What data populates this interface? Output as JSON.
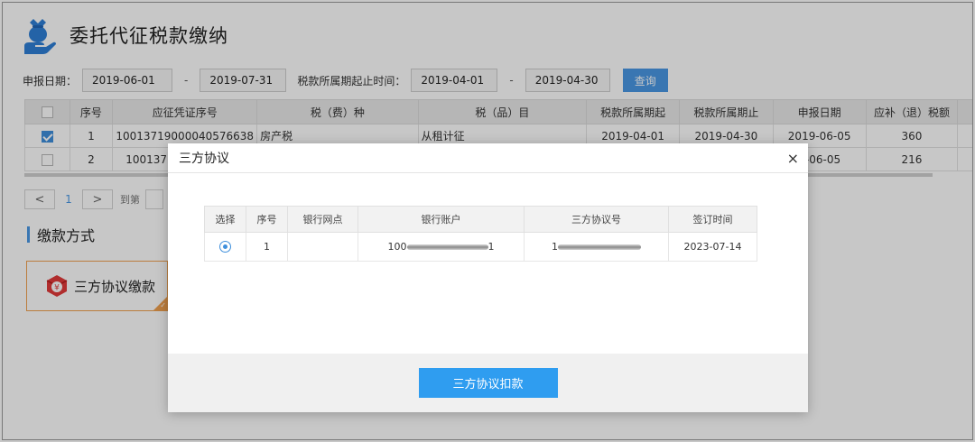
{
  "page": {
    "title": "委托代征税款缴纳"
  },
  "filters": {
    "report_date_label": "申报日期：",
    "report_date_from": "2019-06-01",
    "report_date_to": "2019-07-31",
    "range_separator": "-",
    "tax_period_label": "税款所属期起止时间：",
    "tax_period_from": "2019-04-01",
    "tax_period_to": "2019-04-30",
    "query_button": "查询"
  },
  "table": {
    "columns": [
      "",
      "序号",
      "应征凭证序号",
      "税（费）种",
      "税（品）目",
      "税款所属期起",
      "税款所属期止",
      "申报日期",
      "应补（退）税额"
    ],
    "rows": [
      {
        "checked": true,
        "no": "1",
        "voucher": "10013719000040576638",
        "tax_type": "房产税",
        "tax_item": "从租计征",
        "period_start": "2019-04-01",
        "period_end": "2019-04-30",
        "report_date": "2019-06-05",
        "amount": "360"
      },
      {
        "checked": false,
        "no": "2",
        "voucher": "10013719",
        "tax_type": "",
        "tax_item": "",
        "period_start": "",
        "period_end": "",
        "report_date": "9-06-05",
        "amount": "216"
      }
    ]
  },
  "pager": {
    "prev": "<",
    "current": "1",
    "next": ">",
    "goto_label": "到第"
  },
  "payment": {
    "section_title": "缴款方式",
    "option_label": "三方协议缴款"
  },
  "modal": {
    "title": "三方协议",
    "close": "×",
    "columns": [
      "选择",
      "序号",
      "银行网点",
      "银行账户",
      "三方协议号",
      "签订时间"
    ],
    "rows": [
      {
        "selected": true,
        "no": "1",
        "branch": "",
        "account_prefix": "100",
        "account_suffix": "1",
        "agreement_prefix": "1",
        "signed": "2023-07-14"
      }
    ],
    "confirm_button": "三方协议扣款"
  },
  "colors": {
    "accent": "#4a98e5",
    "confirm": "#2f9df0",
    "card_border": "#f0a050",
    "icon_red": "#e23a3a"
  }
}
